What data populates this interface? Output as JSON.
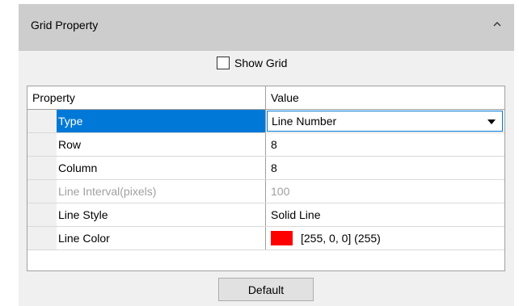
{
  "panel": {
    "title": "Grid Property",
    "collapse_icon": "chevron-up-icon",
    "show_grid_label": "Show Grid",
    "show_grid_checked": false
  },
  "grid": {
    "header_property": "Property",
    "header_value": "Value",
    "rows": [
      {
        "name": "Type",
        "value": "Line Number",
        "selected": true,
        "editor": "dropdown"
      },
      {
        "name": "Row",
        "value": "8"
      },
      {
        "name": "Column",
        "value": "8"
      },
      {
        "name": "Line Interval(pixels)",
        "value": "100",
        "disabled": true
      },
      {
        "name": "Line Style",
        "value": "Solid Line"
      },
      {
        "name": "Line Color",
        "value": "[255, 0, 0] (255)",
        "swatch_color": "#ff0000"
      }
    ]
  },
  "footer": {
    "default_label": "Default"
  },
  "colors": {
    "header_bg": "#cdcdcd",
    "panel_bg": "#f0f0f0",
    "selection": "#0078d7",
    "disabled_text": "#a0a0a0"
  }
}
